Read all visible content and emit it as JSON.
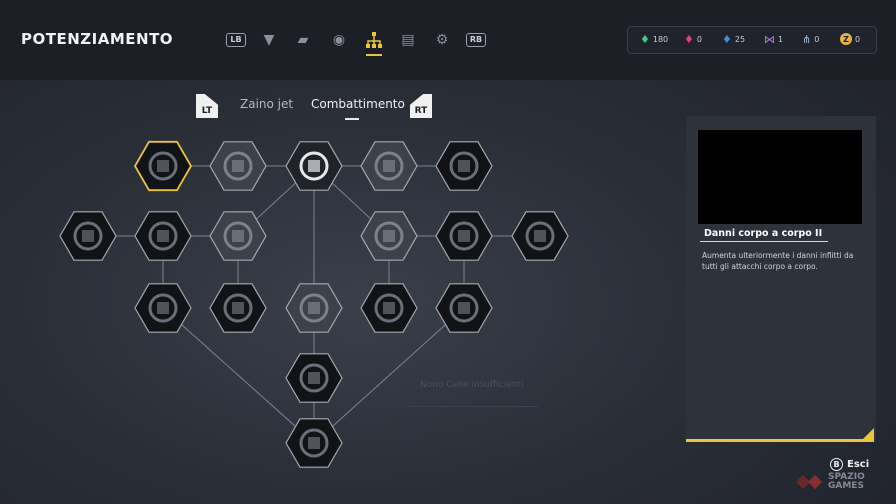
{
  "header": {
    "title": "POTENZIAMENTO",
    "nav": [
      {
        "name": "lb-button-hint",
        "label": "LB",
        "type": "pill"
      },
      {
        "name": "chevron-down-icon",
        "glyph": "▼"
      },
      {
        "name": "weapon-icon",
        "glyph": "▰"
      },
      {
        "name": "helmet-icon",
        "glyph": "◉"
      },
      {
        "name": "skill-tree-icon",
        "glyph": "⛭",
        "active": true
      },
      {
        "name": "notes-icon",
        "glyph": "▤"
      },
      {
        "name": "gear-icon",
        "glyph": "⚙"
      },
      {
        "name": "rb-button-hint",
        "label": "RB",
        "type": "pill"
      }
    ]
  },
  "currencies": [
    {
      "name": "green-cells",
      "value": "180",
      "color": "#3ecf8e",
      "glyph": "♦"
    },
    {
      "name": "pink-cells",
      "value": "0",
      "color": "#e0447a",
      "glyph": "♦"
    },
    {
      "name": "blue-cells",
      "value": "25",
      "color": "#3a8fe0",
      "glyph": "♦"
    },
    {
      "name": "nodes",
      "value": "1",
      "color": "#b07fe8",
      "glyph": "⋈"
    },
    {
      "name": "links",
      "value": "0",
      "color": "#9fb4d6",
      "glyph": "⋔"
    },
    {
      "name": "credits",
      "value": "0",
      "color": "#e9b23d",
      "glyph": "Z"
    }
  ],
  "tabs": {
    "lt": "LT",
    "rt": "RT",
    "items": [
      "Zaino jet",
      "Combattimento"
    ],
    "selected": 1
  },
  "skill_tree": {
    "nodes": [
      {
        "id": "a1",
        "icon": "cube-icon",
        "state": "selected"
      },
      {
        "id": "a2",
        "icon": "cube-icon",
        "state": "locked"
      },
      {
        "id": "a3",
        "icon": "shield-icon",
        "state": "available"
      },
      {
        "id": "a4",
        "icon": "core-icon",
        "state": "locked"
      },
      {
        "id": "a5",
        "icon": "core-icon",
        "state": "unlocked"
      },
      {
        "id": "b1",
        "icon": "ram-icon",
        "state": "unlocked"
      },
      {
        "id": "b2",
        "icon": "ram-icon",
        "state": "unlocked"
      },
      {
        "id": "b3",
        "icon": "ram-icon",
        "state": "locked"
      },
      {
        "id": "b4",
        "icon": "shield-icon",
        "state": "locked"
      },
      {
        "id": "b5",
        "icon": "shield-icon",
        "state": "unlocked"
      },
      {
        "id": "b6",
        "icon": "shield-icon",
        "state": "unlocked"
      },
      {
        "id": "c1",
        "icon": "runner-icon",
        "state": "unlocked"
      },
      {
        "id": "c2",
        "icon": "hourglass-icon",
        "state": "unlocked"
      },
      {
        "id": "c3",
        "icon": "rock-icon",
        "state": "locked"
      },
      {
        "id": "c4",
        "icon": "grid-shield-icon",
        "state": "unlocked"
      },
      {
        "id": "c5",
        "icon": "sprint-icon",
        "state": "unlocked"
      },
      {
        "id": "d1",
        "icon": "vortex-icon",
        "state": "unlocked"
      },
      {
        "id": "e1",
        "icon": "dive-icon",
        "state": "unlocked"
      }
    ]
  },
  "ghost_text": "Nono Celle insufficienti",
  "details": {
    "skill_name": "Danni corpo a corpo II",
    "description": "Aumenta ulteriormente i danni inflitti da tutti gli attacchi corpo a corpo."
  },
  "footer": {
    "exit_button": "B",
    "exit_label": "Esci",
    "watermark_top": "SPAZIO",
    "watermark_bottom": "GAMES"
  },
  "colors": {
    "accent": "#e9c43d",
    "node_fill": "#121418",
    "node_border": "#9aa0aa"
  }
}
